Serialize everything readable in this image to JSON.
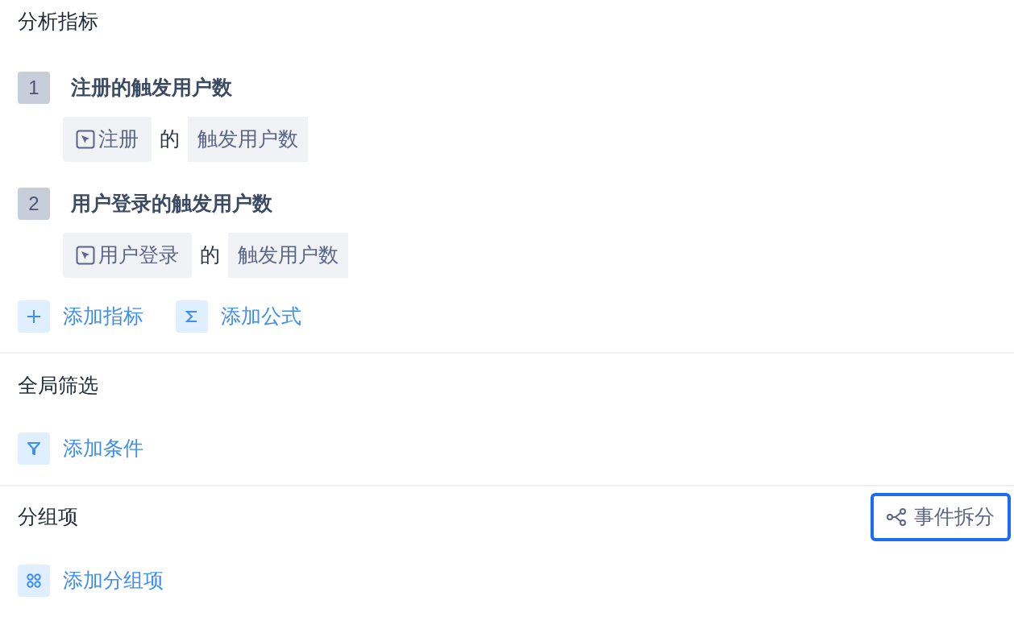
{
  "sections": [
    {
      "title": "分析指标",
      "metrics": [
        {
          "index": "1",
          "name": "注册的触发用户数",
          "event": "注册",
          "connector": "的",
          "measure": "触发用户数"
        },
        {
          "index": "2",
          "name": "用户登录的触发用户数",
          "event": "用户登录",
          "connector": "的",
          "measure": "触发用户数"
        }
      ],
      "actions": [
        {
          "kind": "plus",
          "label": "添加指标"
        },
        {
          "kind": "sigma",
          "label": "添加公式"
        }
      ]
    },
    {
      "title": "全局筛选",
      "actions": [
        {
          "kind": "filter",
          "label": "添加条件"
        }
      ]
    },
    {
      "title": "分组项",
      "side_button": {
        "label": "事件拆分",
        "highlighted": true
      },
      "actions": [
        {
          "kind": "group",
          "label": "添加分组项"
        }
      ]
    }
  ]
}
